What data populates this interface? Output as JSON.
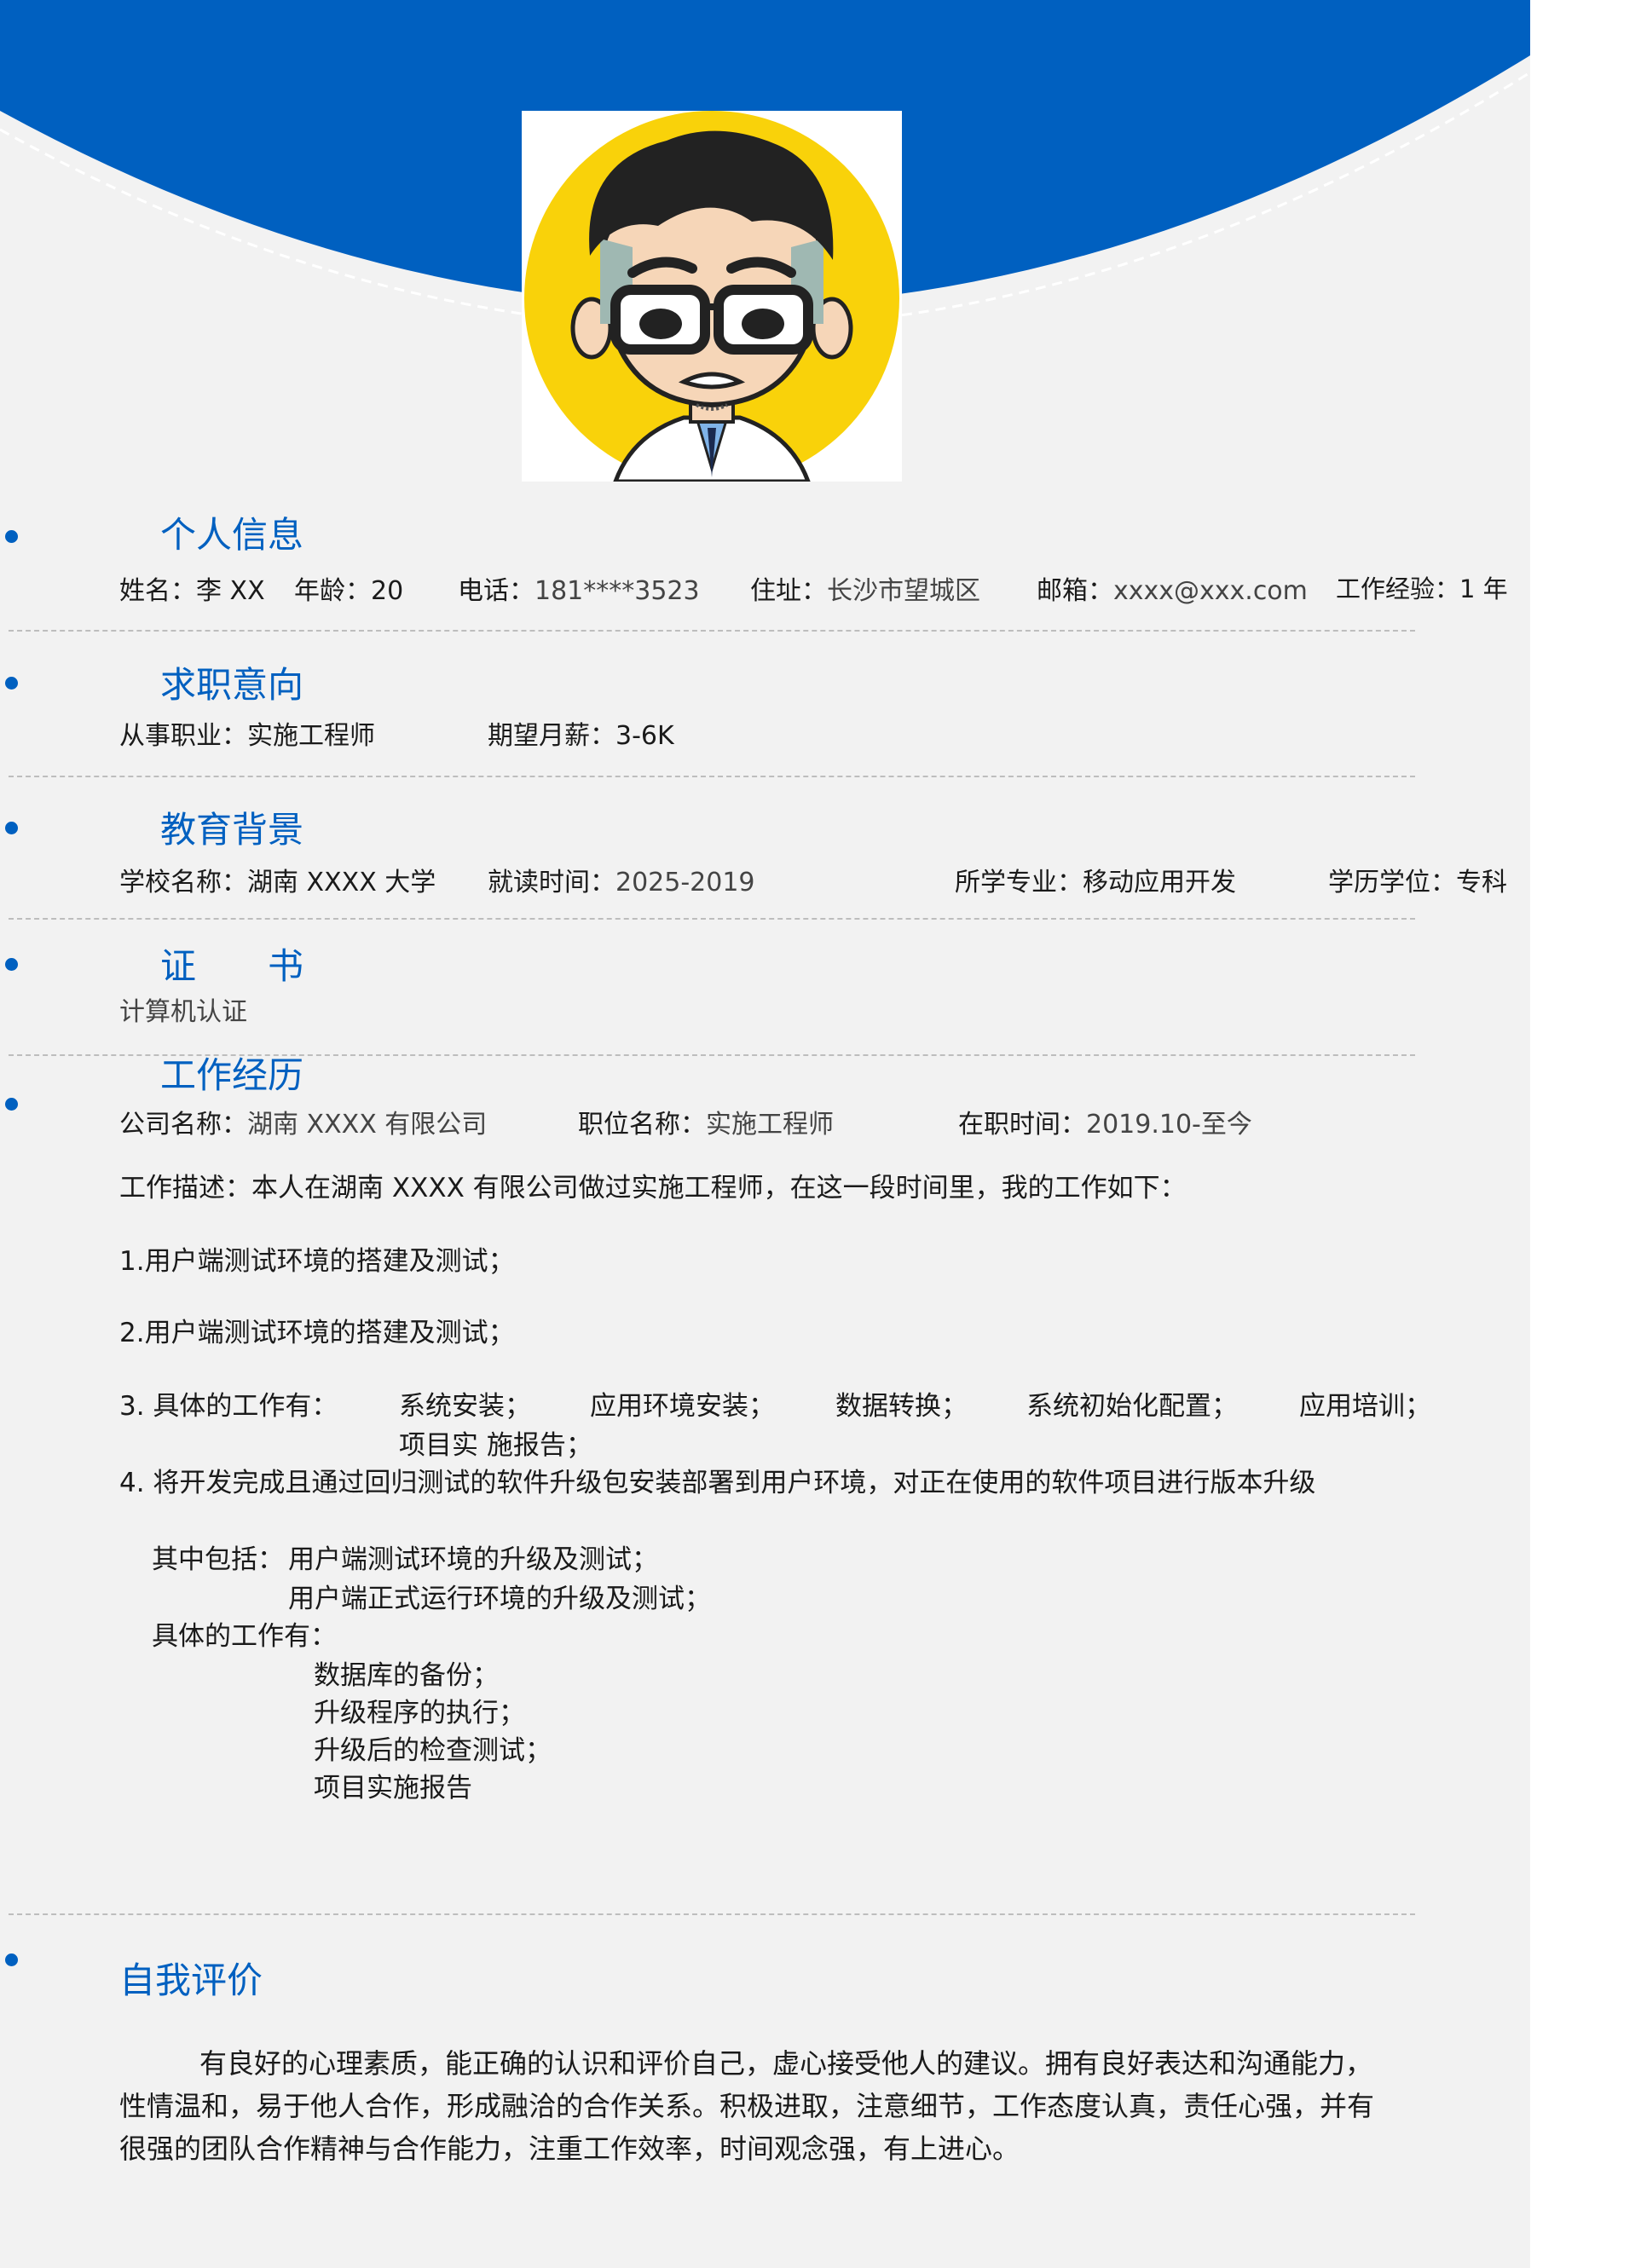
{
  "colors": {
    "accent": "#0060c0",
    "page_bg": "#f2f2f2",
    "avatar_circle": "#f9d20a"
  },
  "avatar": {
    "icon": "cartoon-man-avatar"
  },
  "sections": {
    "personal": {
      "heading": "个人信息",
      "name": "姓名：李 XX",
      "age": "年龄：20",
      "phone_label": "电话：",
      "phone": "181****3523",
      "address_label": "住址：",
      "address": "长沙市望城区",
      "email_label": "邮箱：",
      "email": "xxxx@xxx.com",
      "experience": "工作经验：1 年"
    },
    "intent": {
      "heading": "求职意向",
      "job": "从事职业：实施工程师",
      "salary": "期望月薪：3-6K"
    },
    "education": {
      "heading": "教育背景",
      "school": "学校名称：湖南 XXXX 大学",
      "period_label": "就读时间：",
      "period": "2025-2019",
      "major": "所学专业：移动应用开发",
      "degree": "学历学位：专科"
    },
    "certificate": {
      "heading": "证　　书",
      "item": "计算机认证"
    },
    "work": {
      "heading": "工作经历",
      "company_label": "公司名称：",
      "company": "湖南 XXXX 有限公司",
      "position_label": "职位名称：",
      "position": "实施工程师",
      "tenure_label": "在职时间：",
      "tenure": "2019.10-至今",
      "desc": "工作描述：本人在湖南 XXXX 有限公司做过实施工程师，在这一段时间里，我的工作如下：",
      "item1": "1.用户端测试环境的搭建及测试；",
      "item2": "2.用户端测试环境的搭建及测试；",
      "item3_label": "3. 具体的工作有：",
      "item3_tasks": [
        "系统安装；",
        "应用环境安装；",
        "数据转换；",
        "系统初始化配置；",
        "应用培训；"
      ],
      "item3_last": "项目实 施报告；",
      "item4": "4. 将开发完成且通过回归测试的软件升级包安装部署到用户环境，对正在使用的软件项目进行版本升级",
      "includes_label": "其中包括：",
      "includes": [
        "用户端测试环境的升级及测试；",
        "用户端正式运行环境的升级及测试；"
      ],
      "tasks_label": "具体的工作有：",
      "tasks": [
        "数据库的备份；",
        "升级程序的执行；",
        "升级后的检查测试；",
        "项目实施报告"
      ]
    },
    "self_eval": {
      "heading": "自我评价",
      "text": "有良好的心理素质，能正确的认识和评价自己，虚心接受他人的建议。拥有良好表达和沟通能力，性情温和，易于他人合作，形成融洽的合作关系。积极进取，注意细节，工作态度认真，责任心强，并有很强的团队合作精神与合作能力，注重工作效率，时间观念强，有上进心。"
    }
  }
}
